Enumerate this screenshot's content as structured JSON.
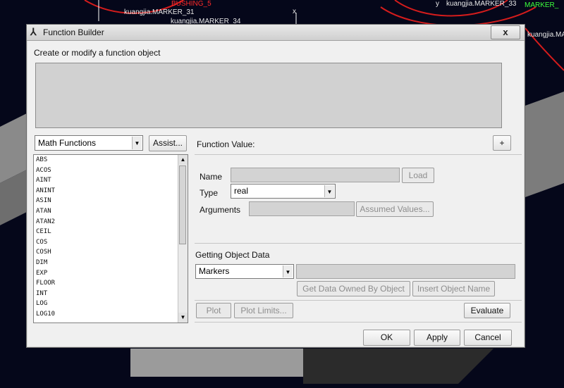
{
  "background": {
    "labels": [
      {
        "text": "kuangjia.MARKER_31",
        "color": "white"
      },
      {
        "text": "kuangjia.MARKER_34",
        "color": "white"
      },
      {
        "text": "BUSHING_5",
        "color": "red"
      },
      {
        "text": "kuangjia.MARKER_33",
        "color": "white"
      },
      {
        "text": "MARKER_",
        "color": "green"
      },
      {
        "text": "kuangjia.MARKE",
        "color": "white"
      },
      {
        "text": "x",
        "color": "white"
      },
      {
        "text": "y",
        "color": "white"
      }
    ]
  },
  "window": {
    "title": "Function Builder",
    "close_symbol": "x",
    "description_label": "Create or modify a function object"
  },
  "left_panel": {
    "category_select": "Math Functions",
    "assist_button": "Assist...",
    "functions": [
      "ABS",
      "ACOS",
      "AINT",
      "ANINT",
      "ASIN",
      "ATAN",
      "ATAN2",
      "CEIL",
      "COS",
      "COSH",
      "DIM",
      "EXP",
      "FLOOR",
      "INT",
      "LOG",
      "LOG10"
    ]
  },
  "right_panel": {
    "function_value_label": "Function Value:",
    "plus_button": "+",
    "name_label": "Name",
    "load_button": "Load",
    "type_label": "Type",
    "type_value": "real",
    "arguments_label": "Arguments",
    "assumed_values_button": "Assumed Values...",
    "getting_object_data_label": "Getting Object Data",
    "object_select": "Markers",
    "get_data_button": "Get Data Owned By Object",
    "insert_name_button": "Insert Object Name",
    "plot_button": "Plot",
    "plot_limits_button": "Plot Limits...",
    "evaluate_button": "Evaluate"
  },
  "footer": {
    "ok_button": "OK",
    "apply_button": "Apply",
    "cancel_button": "Cancel"
  }
}
